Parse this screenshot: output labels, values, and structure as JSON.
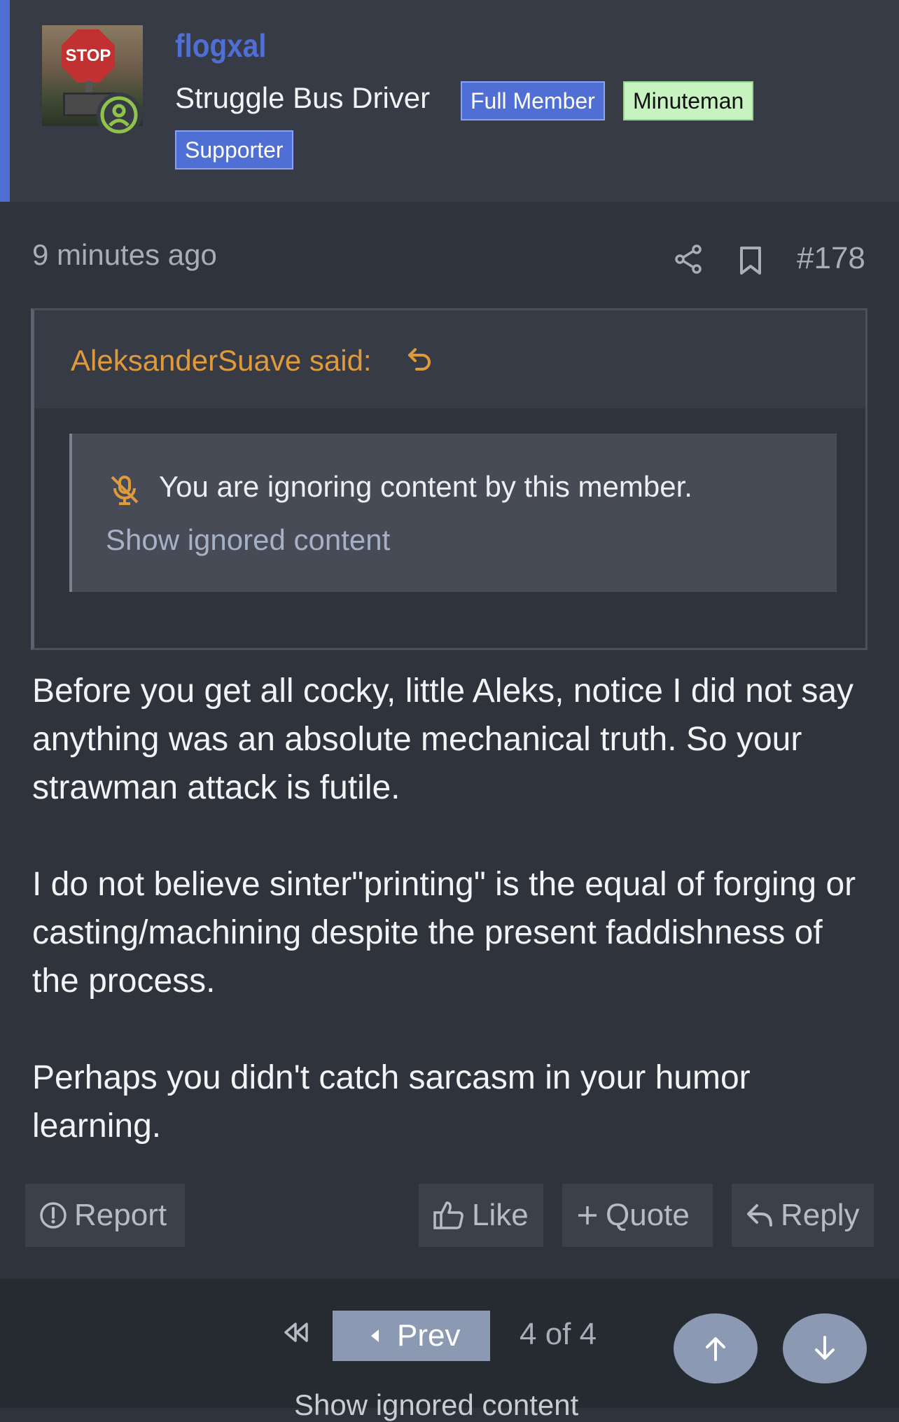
{
  "post": {
    "username": "flogxal",
    "user_title": "Struggle Bus Driver",
    "avatar_text": "STOP",
    "banners": [
      "Full Member",
      "Minuteman",
      "Supporter"
    ],
    "time": "9 minutes ago",
    "post_number": "#178",
    "quote": {
      "author_label": "AleksanderSuave said:",
      "ignored_message": "You are ignoring content by this member.",
      "show_ignored_link": "Show ignored content"
    },
    "body": [
      "Before you get all cocky, little Aleks, notice I did not say anything was an absolute mechanical truth. So your strawman attack is futile.",
      "I do not believe sinter\"printing\" is the equal of forging or casting/machining despite the present faddishness of the process.",
      "Perhaps you didn't catch sarcasm in your humor learning."
    ],
    "actions": {
      "report": "Report",
      "like": "Like",
      "quote": "Quote",
      "reply": "Reply"
    }
  },
  "pagination": {
    "prev_label": "Prev",
    "page_indicator": "4 of 4"
  },
  "footer_peek_text": "Show ignored content",
  "colors": {
    "background": "#2f333c",
    "header_background": "#363b45",
    "accent_blue": "#4f6fd4",
    "quote_author_orange": "#e09a3a",
    "minuteman_green": "#c6f3c0",
    "online_green": "#8fc34a",
    "nav_button": "#8b99b3"
  },
  "icons": {
    "online": "user-circle-icon",
    "share": "share-icon",
    "bookmark": "bookmark-icon",
    "quote_jump": "jump-to-quote-icon",
    "mute": "microphone-slash-icon",
    "report": "exclamation-circle-icon",
    "like": "thumbs-up-icon",
    "quote": "plus-icon",
    "reply": "reply-arrow-icon",
    "first_page": "double-chevron-left-icon",
    "prev": "caret-left-icon",
    "scroll_top": "arrow-up-icon",
    "scroll_bottom": "arrow-down-icon"
  }
}
